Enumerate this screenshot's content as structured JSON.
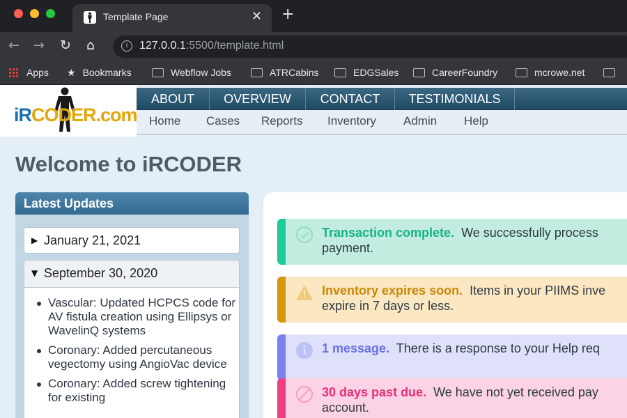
{
  "browser": {
    "tab_title": "Template Page",
    "tab_close": "✕",
    "new_tab": "+",
    "url_host": "127.0.0.1",
    "url_rest": ":5500/template.html",
    "bookmarks": [
      "Apps",
      "Bookmarks",
      "Webflow Jobs",
      "ATRCabins",
      "EDGSales",
      "CareerFoundry",
      "mcrowe.net"
    ]
  },
  "site": {
    "logo_ir": "iR",
    "logo_coder": "CODER.com",
    "main_nav": [
      "ABOUT",
      "OVERVIEW",
      "CONTACT",
      "TESTIMONIALS"
    ],
    "sub_nav": [
      "Home",
      "Cases",
      "Reports",
      "Inventory",
      "Admin",
      "Help"
    ]
  },
  "page": {
    "title": "Welcome to iRCODER"
  },
  "updates": {
    "heading": "Latest Updates",
    "collapsed_arrow": "▶",
    "expanded_arrow": "▼",
    "items": [
      {
        "date": "January 21, 2021"
      },
      {
        "date": "September 30, 2020",
        "entries": [
          "Vascular: Updated HCPCS code for AV fistula creation using Ellipsys or WavelinQ systems",
          "Coronary: Added percutaneous vegectomy using AngioVac device",
          "Coronary: Added screw tightening for existing"
        ]
      }
    ]
  },
  "alerts": [
    {
      "title": "Transaction complete.",
      "line1": "We successfully process",
      "line2": "payment.",
      "color": "#1ec99a"
    },
    {
      "title": "Inventory expires soon.",
      "line1": "Items in your PIIMS inve",
      "line2": "expire in 7 days or less.",
      "color": "#d8960f"
    },
    {
      "title": "1 message.",
      "line1": "There is a response to your Help req",
      "line2": "",
      "color": "#7b82ee"
    },
    {
      "title": "30 days past due.",
      "line1": "We have not yet received pay",
      "line2": "account.",
      "color": "#ef3f84"
    }
  ]
}
